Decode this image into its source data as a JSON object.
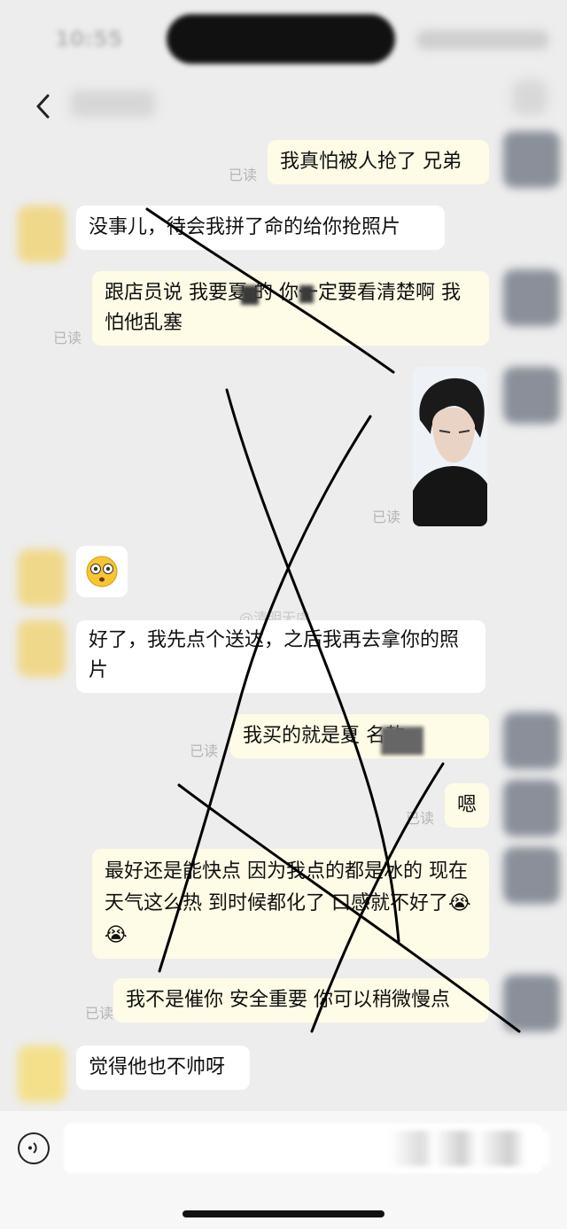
{
  "status_bar": {
    "time": "10:55"
  },
  "messages": [
    {
      "sender": "me",
      "text": "我真怕被人抢了 兄弟",
      "status": "已读"
    },
    {
      "sender": "other",
      "text": "没事儿，待会我拼了命的给你抢照片"
    },
    {
      "sender": "me",
      "text": "跟店员说 我要夏 的 你一定要看清楚啊 我怕他乱塞",
      "status": "已读"
    },
    {
      "sender": "me",
      "type": "image",
      "status": "已读"
    },
    {
      "sender": "other",
      "type": "emoji",
      "emoji": "😳"
    },
    {
      "sender": "other",
      "text": "好了，我先点个送达，之后我再去拿你的照片"
    },
    {
      "sender": "me",
      "text": "我买的就是夏 名款",
      "status": "已读"
    },
    {
      "sender": "me",
      "text": "嗯",
      "status": "已读"
    },
    {
      "sender": "me",
      "text": "最好还是能快点 因为我点的都是冰的 现在天气这么热 到时候都化了 口感就不好了😭😭"
    },
    {
      "sender": "me",
      "text": "我不是催你 安全重要 你可以稍微慢点",
      "status": "已读"
    },
    {
      "sender": "other",
      "text": "觉得他也不帅呀"
    }
  ],
  "watermark": "@清明无虞",
  "colors": {
    "my_bubble": "#fefce6",
    "their_bubble": "#ffffff",
    "background": "#ededed",
    "scribble": "#000000"
  },
  "icons": {
    "back": "chevron-left-icon",
    "voice": "voice-input-icon"
  }
}
